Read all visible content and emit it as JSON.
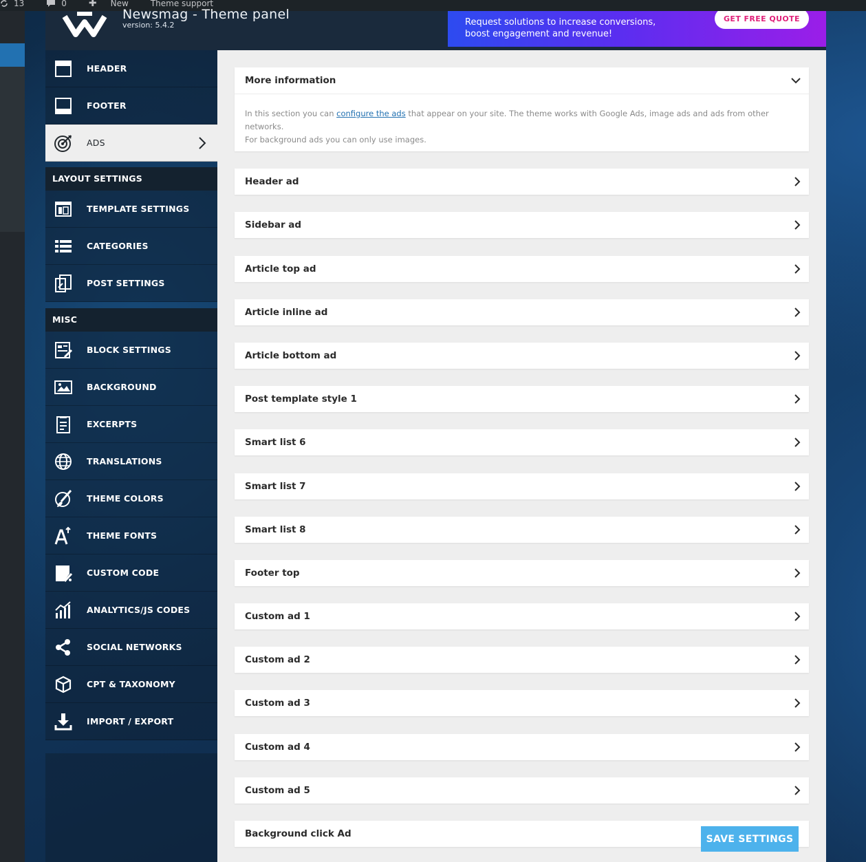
{
  "adminbar": {
    "updates_count": "13",
    "comments_count": "0",
    "new_label": "New",
    "theme_support": "Theme support"
  },
  "header": {
    "title": "Newsmag - Theme panel",
    "version": "version: 5.4.2",
    "promo_line1": "Request solutions to increase conversions,",
    "promo_line2": "boost engagement and revenue!",
    "promo_button": "GET FREE QUOTE"
  },
  "sidebar": {
    "items_top": [
      {
        "label": "HEADER",
        "icon": "header-icon"
      },
      {
        "label": "FOOTER",
        "icon": "footer-icon"
      },
      {
        "label": "ADS",
        "icon": "target-icon",
        "active": true
      }
    ],
    "section_layout": "LAYOUT SETTINGS",
    "items_layout": [
      {
        "label": "TEMPLATE SETTINGS",
        "icon": "template-icon"
      },
      {
        "label": "CATEGORIES",
        "icon": "list-icon"
      },
      {
        "label": "POST SETTINGS",
        "icon": "post-icon"
      }
    ],
    "section_misc": "MISC",
    "items_misc": [
      {
        "label": "BLOCK SETTINGS",
        "icon": "block-icon"
      },
      {
        "label": "BACKGROUND",
        "icon": "image-icon"
      },
      {
        "label": "EXCERPTS",
        "icon": "excerpt-icon"
      },
      {
        "label": "TRANSLATIONS",
        "icon": "globe-icon"
      },
      {
        "label": "THEME COLORS",
        "icon": "brush-icon"
      },
      {
        "label": "THEME FONTS",
        "icon": "font-icon"
      },
      {
        "label": "CUSTOM CODE",
        "icon": "code-icon"
      },
      {
        "label": "ANALYTICS/JS CODES",
        "icon": "analytics-icon"
      },
      {
        "label": "SOCIAL NETWORKS",
        "icon": "share-icon"
      },
      {
        "label": "CPT & TAXONOMY",
        "icon": "cube-icon"
      },
      {
        "label": "IMPORT / EXPORT",
        "icon": "download-icon"
      }
    ]
  },
  "content": {
    "info_title": "More information",
    "info_text_before": "In this section you can ",
    "info_link": "configure the ads",
    "info_text_after": " that appear on your site. The theme works with Google Ads, image ads and ads from other networks.",
    "info_text_line2": "For background ads you can only use images.",
    "sections": [
      "Header ad",
      "Sidebar ad",
      "Article top ad",
      "Article inline ad",
      "Article bottom ad",
      "Post template style 1",
      "Smart list 6",
      "Smart list 7",
      "Smart list 8",
      "Footer top",
      "Custom ad 1",
      "Custom ad 2",
      "Custom ad 3",
      "Custom ad 4",
      "Custom ad 5",
      "Background click Ad"
    ],
    "save_button": "SAVE SETTINGS"
  }
}
